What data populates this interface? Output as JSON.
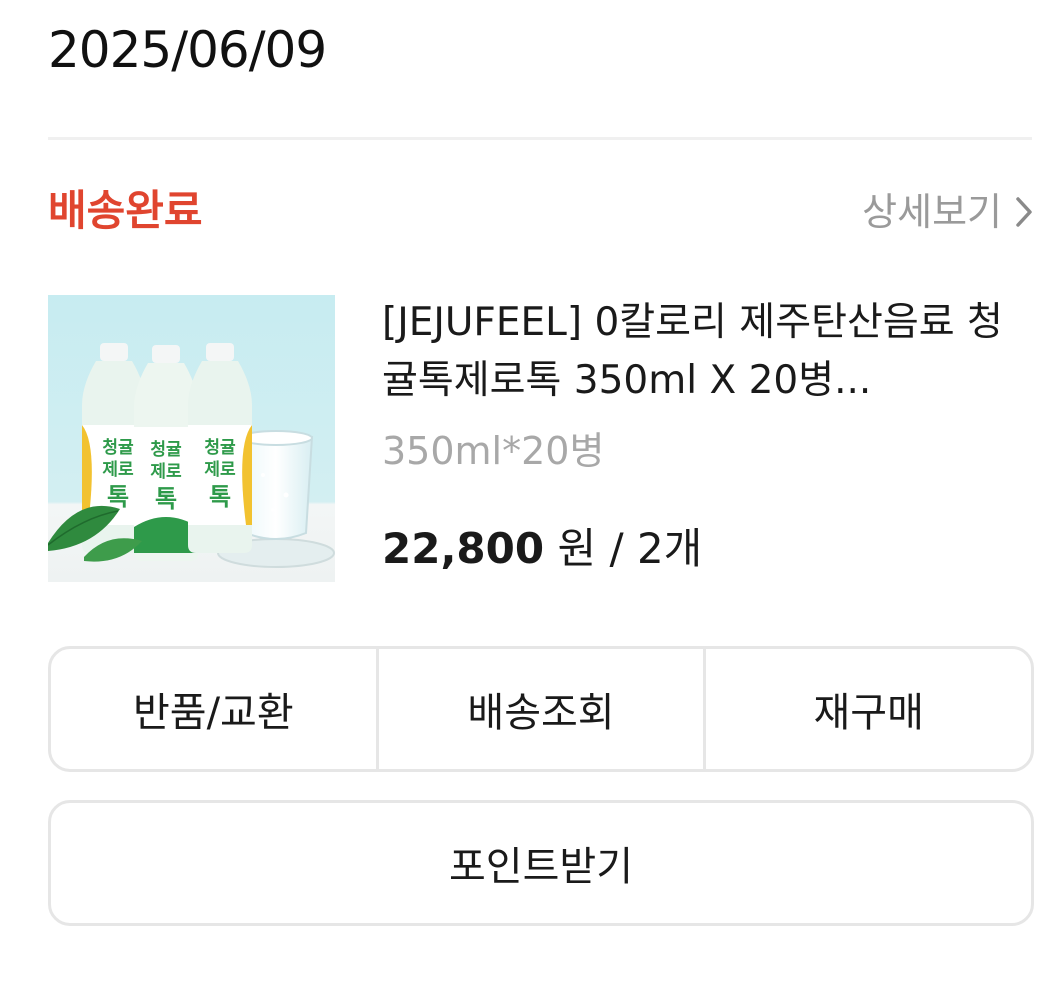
{
  "order": {
    "date": "2025/06/09",
    "status": "배송완료",
    "status_color": "#e0452f",
    "detail_label": "상세보기",
    "detail_icon": "chevron-right-icon"
  },
  "product": {
    "name": "[JEJUFEEL] 0칼로리 제주탄산음료 청귤톡제로톡 350ml X 20병...",
    "option": "350ml*20병",
    "price": "22,800",
    "price_unit": "원",
    "separator": "/",
    "quantity": "2개",
    "image_label_top": "청귤",
    "image_label_mid": "제로",
    "image_label_bottom": "톡"
  },
  "actions": {
    "return_exchange": "반품/교환",
    "track_delivery": "배송조회",
    "reorder": "재구매",
    "get_points": "포인트받기"
  }
}
